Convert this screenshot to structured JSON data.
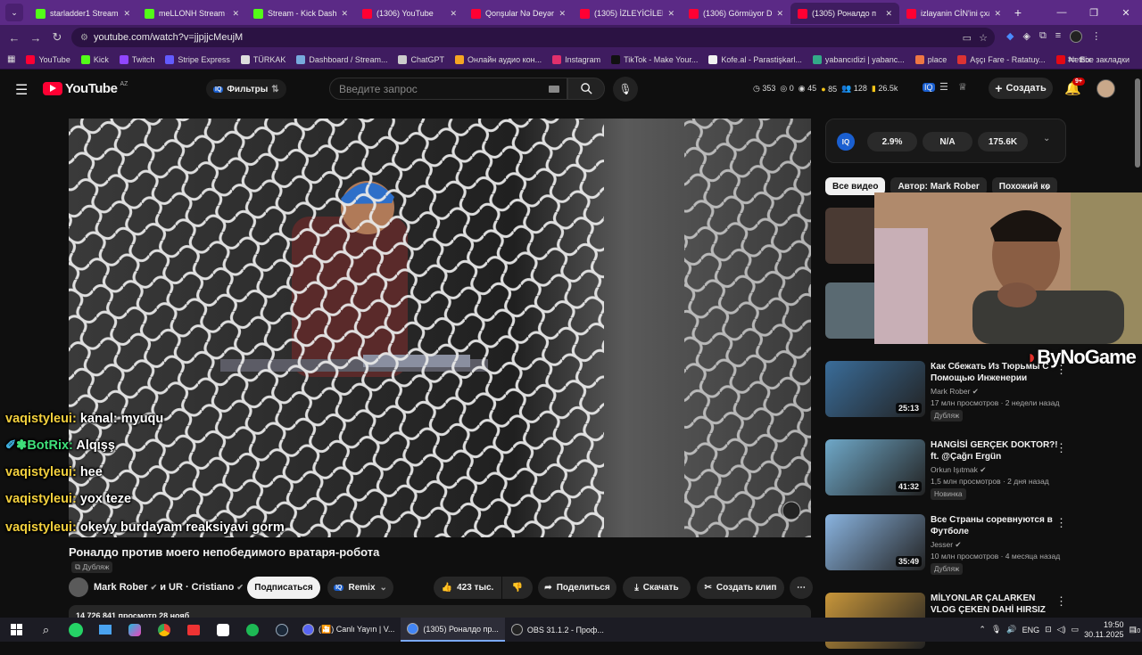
{
  "browser": {
    "tabs": [
      {
        "title": "starladder1 Stream - ",
        "color": "#53fc18",
        "active": false
      },
      {
        "title": "meLLONH Stream - W",
        "color": "#53fc18",
        "active": false
      },
      {
        "title": "Stream - Kick Dashbo",
        "color": "#53fc18",
        "active": false
      },
      {
        "title": "(1306) YouTube",
        "color": "#ff0033",
        "active": false
      },
      {
        "title": "Qonşular Nə Deyər - ",
        "color": "#ff0033",
        "active": false
      },
      {
        "title": "(1305) İZLEYİCİLERİN",
        "color": "#ff0033",
        "active": false
      },
      {
        "title": "(1306) Görmüyor Du",
        "color": "#ff0033",
        "active": false
      },
      {
        "title": "(1305) Роналдо п",
        "color": "#ff0033",
        "active": true
      },
      {
        "title": "izlayanin CİN'ini çxa",
        "color": "#ff0033",
        "active": false
      }
    ],
    "url": "youtube.com/watch?v=jjpjjcMeujM",
    "bookmarks": [
      {
        "label": "YouTube",
        "color": "#ff0033"
      },
      {
        "label": "Kick",
        "color": "#53fc18"
      },
      {
        "label": "Twitch",
        "color": "#9146ff"
      },
      {
        "label": "Stripe Express",
        "color": "#635bff"
      },
      {
        "label": "TÜRKAK",
        "color": "#dddddd"
      },
      {
        "label": "Dashboard / Stream...",
        "color": "#7ad"
      },
      {
        "label": "ChatGPT",
        "color": "#cccccc"
      },
      {
        "label": "Онлайн аудио кон...",
        "color": "#f5a623"
      },
      {
        "label": "Instagram",
        "color": "#e1306c"
      },
      {
        "label": "TikTok - Make Your...",
        "color": "#111111"
      },
      {
        "label": "Kofe.al - Parastişkarl...",
        "color": "#f1f1f1"
      },
      {
        "label": "yabancıdizi | yabanc...",
        "color": "#3a8"
      },
      {
        "label": "place",
        "color": "#e74"
      },
      {
        "label": "Aşçı Fare - Ratatuy...",
        "color": "#d33"
      },
      {
        "label": "Netflix",
        "color": "#e50914"
      }
    ],
    "bookmarks_more": "Все закладки"
  },
  "youtube": {
    "logo": "YouTube",
    "region": "AZ",
    "filters_label": "Фильтры",
    "search_placeholder": "Введите запрос",
    "stats": [
      "353",
      "0",
      "45",
      "85",
      "128",
      "26.5k"
    ],
    "create_label": "Создать",
    "notif_count": "9+",
    "iq": {
      "logo": "IQ",
      "values": [
        "2.9%",
        "N/A",
        "175.6K"
      ]
    },
    "chips": [
      "Все видео",
      "Автор: Mark Rober",
      "Похожий ко"
    ],
    "video_title": "Роналдо против моего непобедимого вратаря-робота",
    "dub_label": "Дубляж",
    "channel": "Mark Rober",
    "collab": "и UR · Cristiano",
    "subscribe_label": "Подписаться",
    "remix_label": "Remix",
    "likes": "423 тыс.",
    "share_label": "Поделиться",
    "download_label": "Скачать",
    "clip_label": "Создать клип",
    "views_line": "14 726 841 просмотр  28 нояб",
    "recommendations": [
      {
        "title": "Как Сбежать Из Тюрьмы С Помощью Инженерии",
        "channel": "Mark Rober",
        "meta": "17 млн просмотров · 2 недели назад",
        "duration": "25:13",
        "badge": "Дубляж",
        "color": "#3a6d9a"
      },
      {
        "title": "HANGİSİ GERÇEK DOKTOR?! ft. @Çağrı Ergün",
        "channel": "Orkun Işıtmak",
        "meta": "1,5 млн просмотров · 2 дня назад",
        "duration": "41:32",
        "badge": "Новинка",
        "color": "#6fa8c8"
      },
      {
        "title": "Все Страны соревнуются в Футболе",
        "channel": "Jesser",
        "meta": "10 млн просмотров · 4 месяца назад",
        "duration": "35:49",
        "badge": "Дубляж",
        "color": "#8ab4e0"
      },
      {
        "title": "MİLYONLAR ÇALARKEN VLOG ÇEKEN DAHİ HIRSIZ",
        "channel": "",
        "meta": "",
        "duration": "",
        "badge": "",
        "color": "#c8963a"
      }
    ]
  },
  "overlay": {
    "chat": [
      {
        "user": "vaqistyleui:",
        "text": "kanal: myuqu",
        "bot": false
      },
      {
        "user": "BotRix:",
        "text": "Alqışş",
        "bot": true
      },
      {
        "user": "vaqistyleui:",
        "text": "hee",
        "bot": false
      },
      {
        "user": "vaqistyleui:",
        "text": "yox teze",
        "bot": false
      },
      {
        "user": "vaqistyleui:",
        "text": "okeyy burdayam reaksiyavi gorm",
        "bot": false
      }
    ],
    "streamer_brand": "ByNoGame"
  },
  "taskbar": {
    "apps": [
      {
        "label": "(🎦) Canlı Yayın | V...",
        "active": false
      },
      {
        "label": "(1305) Роналдо пр...",
        "active": true
      },
      {
        "label": "OBS 31.1.2 - Проф...",
        "active": false
      }
    ],
    "lang": "ENG",
    "time": "19:50",
    "date": "30.11.2025",
    "notif_badge": "10"
  }
}
